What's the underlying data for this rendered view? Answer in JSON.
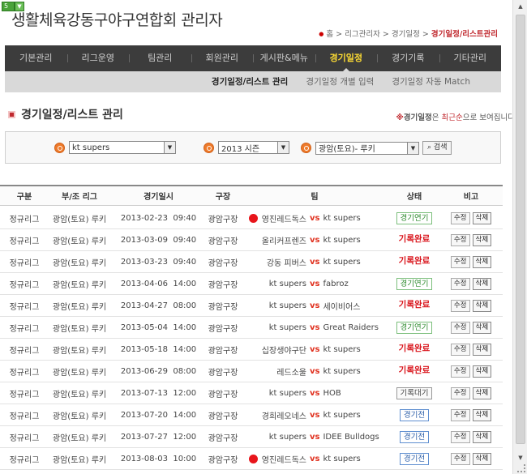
{
  "badge": {
    "num": "5"
  },
  "site_title": "생활체육강동구야구연합회 관리자",
  "breadcrumb": {
    "home": "홈",
    "sep": ">",
    "level1": "리그관리자",
    "level2": "경기일정",
    "current": "경기일정/리스트관리"
  },
  "main_nav": [
    "기본관리",
    "리그운영",
    "팀관리",
    "회원관리",
    "게시판&메뉴",
    "경기일정",
    "경기기록",
    "기타관리"
  ],
  "main_nav_active": 5,
  "sub_nav": [
    "경기일정/리스트 관리",
    "경기일정 개별 입력",
    "경기일정 자동 Match"
  ],
  "sub_nav_active": 0,
  "section_title": "경기일정/리스트 관리",
  "notice": {
    "mark": "※",
    "label": "경기일정",
    "mid": "은",
    "hl": "최근순",
    "tail": "으로 보여집니다."
  },
  "filters": {
    "team": "kt supers",
    "season": "2013 시즌",
    "league": "광암(토요)- 루키",
    "search_label": "검색"
  },
  "columns": {
    "gubun": "구분",
    "league": "부/조 리그",
    "date": "경기일시",
    "field": "구장",
    "team": "팀",
    "status": "상태",
    "action": "비고"
  },
  "labels": {
    "vs": "vs",
    "edit": "수정",
    "delete": "삭제"
  },
  "accent_color": "#c0282e",
  "rows": [
    {
      "gubun": "정규리그",
      "league": "광암(토요) 루키",
      "date": "2013-02-23",
      "time": "09:40",
      "field": "광암구장",
      "home": "영진레드독스",
      "away": "kt supers",
      "status": "경기연기",
      "status_type": "postponed",
      "home_logo": true
    },
    {
      "gubun": "정규리그",
      "league": "광암(토요) 루키",
      "date": "2013-03-09",
      "time": "09:40",
      "field": "광암구장",
      "home": "올리커프렌즈",
      "away": "kt supers",
      "status": "기록완료",
      "status_type": "done",
      "home_logo": false
    },
    {
      "gubun": "정규리그",
      "league": "광암(토요) 루키",
      "date": "2013-03-23",
      "time": "09:40",
      "field": "광암구장",
      "home": "강동 피버스",
      "away": "kt supers",
      "status": "기록완료",
      "status_type": "done",
      "home_logo": false
    },
    {
      "gubun": "정규리그",
      "league": "광암(토요) 루키",
      "date": "2013-04-06",
      "time": "14:00",
      "field": "광암구장",
      "home": "kt supers",
      "away": "fabroz",
      "status": "경기연기",
      "status_type": "postponed",
      "home_logo": false
    },
    {
      "gubun": "정규리그",
      "league": "광암(토요) 루키",
      "date": "2013-04-27",
      "time": "08:00",
      "field": "광암구장",
      "home": "kt supers",
      "away": "세이비어스",
      "status": "기록완료",
      "status_type": "done",
      "home_logo": false
    },
    {
      "gubun": "정규리그",
      "league": "광암(토요) 루키",
      "date": "2013-05-04",
      "time": "14:00",
      "field": "광암구장",
      "home": "kt supers",
      "away": "Great Raiders",
      "status": "경기연기",
      "status_type": "postponed",
      "home_logo": false
    },
    {
      "gubun": "정규리그",
      "league": "광암(토요) 루키",
      "date": "2013-05-18",
      "time": "14:00",
      "field": "광암구장",
      "home": "십장생야구단",
      "away": "kt supers",
      "status": "기록완료",
      "status_type": "done",
      "home_logo": false
    },
    {
      "gubun": "정규리그",
      "league": "광암(토요) 루키",
      "date": "2013-06-29",
      "time": "08:00",
      "field": "광암구장",
      "home": "레드소울",
      "away": "kt supers",
      "status": "기록완료",
      "status_type": "done",
      "home_logo": false
    },
    {
      "gubun": "정규리그",
      "league": "광암(토요) 루키",
      "date": "2013-07-13",
      "time": "12:00",
      "field": "광암구장",
      "home": "kt supers",
      "away": "HOB",
      "status": "기록대기",
      "status_type": "wait",
      "home_logo": false
    },
    {
      "gubun": "정규리그",
      "league": "광암(토요) 루키",
      "date": "2013-07-20",
      "time": "14:00",
      "field": "광암구장",
      "home": "경희레오네스",
      "away": "kt supers",
      "status": "경기전",
      "status_type": "before",
      "home_logo": false
    },
    {
      "gubun": "정규리그",
      "league": "광암(토요) 루키",
      "date": "2013-07-27",
      "time": "12:00",
      "field": "광암구장",
      "home": "kt supers",
      "away": "IDEE Bulldogs",
      "status": "경기전",
      "status_type": "before",
      "home_logo": false
    },
    {
      "gubun": "정규리그",
      "league": "광암(토요) 루키",
      "date": "2013-08-03",
      "time": "10:00",
      "field": "광암구장",
      "home": "영진레드독스",
      "away": "kt supers",
      "status": "경기전",
      "status_type": "before",
      "home_logo": true
    }
  ]
}
